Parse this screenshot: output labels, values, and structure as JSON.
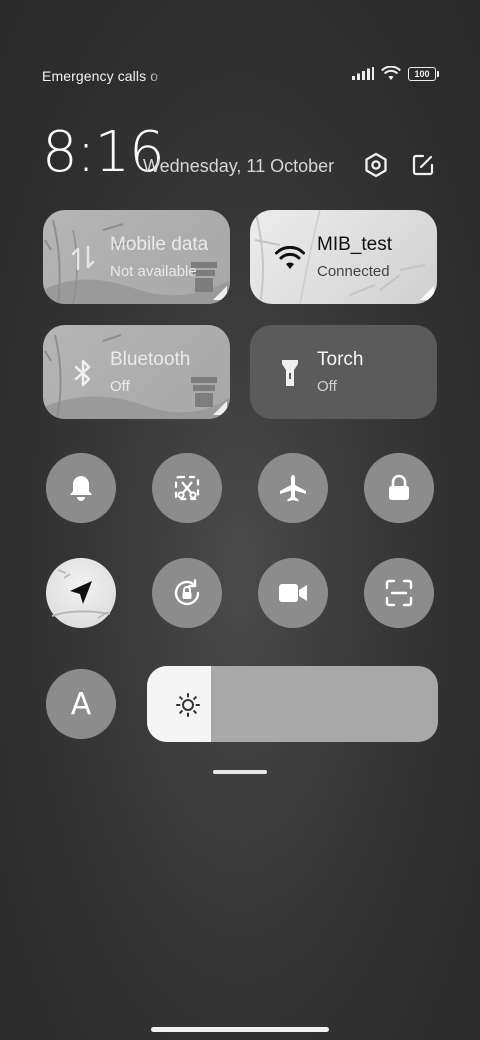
{
  "status_bar": {
    "carrier_text": "Emergency calls o",
    "battery_level": "100"
  },
  "header": {
    "time": "8:16",
    "date": "Wednesday, 11 October"
  },
  "tiles": {
    "mobile_data": {
      "title": "Mobile data",
      "subtitle": "Not available"
    },
    "wifi": {
      "title": "MIB_test",
      "subtitle": "Connected"
    },
    "bluetooth": {
      "title": "Bluetooth",
      "subtitle": "Off"
    },
    "torch": {
      "title": "Torch",
      "subtitle": "Off"
    }
  },
  "round_toggles": [
    {
      "name": "sound",
      "icon": "bell-icon"
    },
    {
      "name": "screenshot",
      "icon": "scissors-icon"
    },
    {
      "name": "airplane-mode",
      "icon": "airplane-icon"
    },
    {
      "name": "lock-screen",
      "icon": "lock-icon"
    },
    {
      "name": "location",
      "icon": "location-arrow-icon"
    },
    {
      "name": "auto-rotate",
      "icon": "rotation-lock-icon"
    },
    {
      "name": "screen-recorder",
      "icon": "video-camera-icon"
    },
    {
      "name": "scanner",
      "icon": "scan-icon"
    },
    {
      "name": "auto-brightness",
      "icon": "letter-a-icon"
    }
  ],
  "auto_brightness_label": "A",
  "brightness": {
    "level": 0.22,
    "icon": "sun-icon"
  },
  "colors": {
    "background": "#333333",
    "toggle_off": "#8c8c8c",
    "tile_active": "#e6e6e6",
    "torch_tile": "#5b5b5b"
  }
}
